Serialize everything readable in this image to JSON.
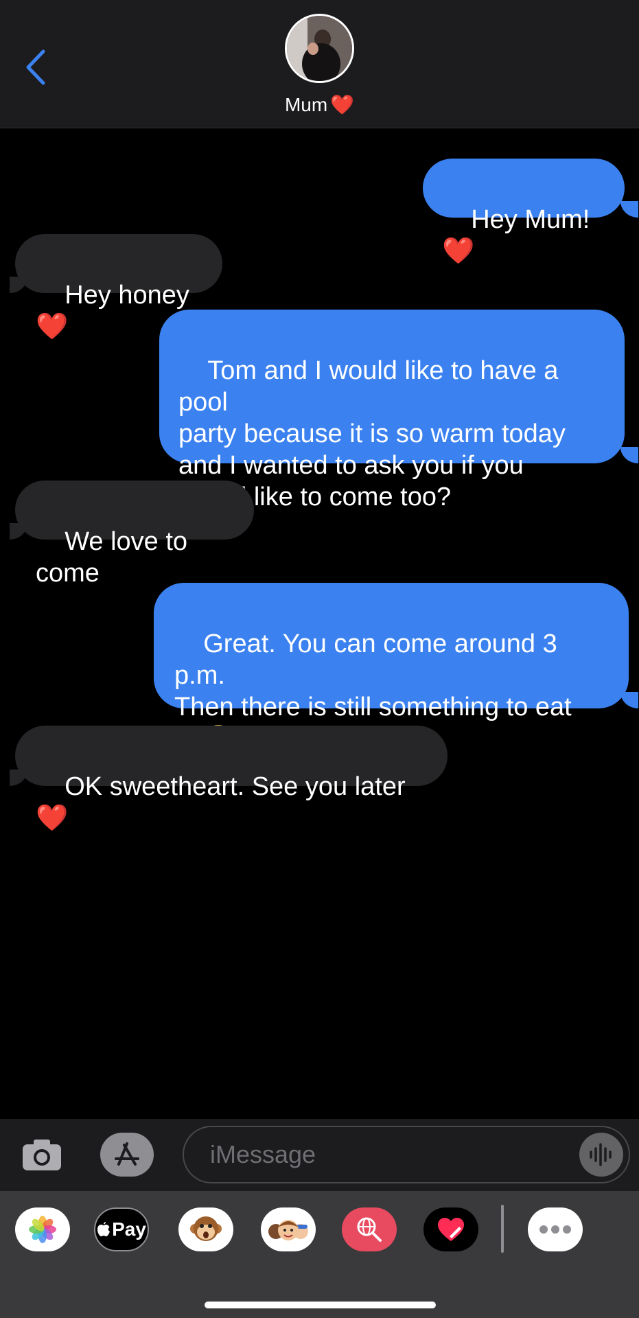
{
  "header": {
    "contact_name": "Mum",
    "contact_emoji": "❤️"
  },
  "messages": [
    {
      "from": "me",
      "text": "Hey Mum!",
      "emoji": "❤️"
    },
    {
      "from": "them",
      "text": "Hey honey",
      "emoji": "❤️"
    },
    {
      "from": "me",
      "text": "Tom and I would like to have a pool\nparty because it is so warm today\nand I wanted to ask you if you\nwould like to come too?"
    },
    {
      "from": "them",
      "text": "We love to come"
    },
    {
      "from": "me",
      "text": "Great. You can come around 3 p.m.\nThen there is still something to eat",
      "emoji": "☺️"
    },
    {
      "from": "them",
      "text": "OK sweetheart. See you later",
      "emoji": "❤️"
    }
  ],
  "input": {
    "placeholder": "iMessage"
  },
  "apps": [
    {
      "name": "photos-icon"
    },
    {
      "name": "apple-pay-icon",
      "label": "Pay"
    },
    {
      "name": "animoji-icon"
    },
    {
      "name": "memoji-icon"
    },
    {
      "name": "images-search-icon"
    },
    {
      "name": "digital-touch-icon"
    },
    {
      "name": "more-apps-icon"
    }
  ],
  "colors": {
    "sent_bubble": "#3b82f0",
    "received_bubble": "#262628",
    "accent": "#3b82f0"
  }
}
